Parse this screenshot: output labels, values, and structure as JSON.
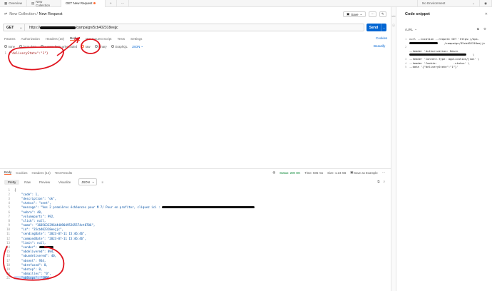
{
  "tabs": [
    {
      "label": "Overview"
    },
    {
      "label": "New Collection"
    },
    {
      "label": "GET New Request"
    }
  ],
  "environment": "No Environment",
  "breadcrumb": {
    "collection": "New Collection",
    "separator": "/",
    "request": "New Request"
  },
  "header": {
    "save_label": "Save",
    "edit_label": "✎"
  },
  "request": {
    "method": "GET",
    "url_prefix": "https://",
    "url_suffix": "/campaign/5cb402318eejjc",
    "send_label": "Send",
    "cookies_label": "Cookies",
    "beautify_label": "Beautify"
  },
  "request_tabs": [
    {
      "label": "Params"
    },
    {
      "label": "Authorization"
    },
    {
      "label": "Headers (10)"
    },
    {
      "label": "Body ●"
    },
    {
      "label": "Pre-request Script"
    },
    {
      "label": "Tests"
    },
    {
      "label": "Settings"
    }
  ],
  "body_options": [
    {
      "label": "none"
    },
    {
      "label": "form-data"
    },
    {
      "label": "x-www-form-urlencoded"
    },
    {
      "label": "raw"
    },
    {
      "label": "binary"
    },
    {
      "label": "GraphQL"
    }
  ],
  "body_format": "JSON",
  "request_body": "{\"deliveryState\":\"1\"}",
  "response": {
    "tabs": [
      {
        "label": "Body"
      },
      {
        "label": "Cookies"
      },
      {
        "label": "Headers (14)"
      },
      {
        "label": "Test Results"
      }
    ],
    "status": "Status: 200 OK",
    "time": "Time: 506 ms",
    "size": "Size: 1.24 KB",
    "save_label": "Save as Example",
    "views": [
      {
        "label": "Pretty"
      },
      {
        "label": "Raw"
      },
      {
        "label": "Preview"
      },
      {
        "label": "Visualize"
      }
    ],
    "view_format": "JSON",
    "lines": [
      "{",
      "    \"code\": 1,",
      "    \"description\": \"ok\",",
      "    \"status\": \"sent\",",
      "    \"message\": \"Vos 2 premières échéances pour M 7/ Pour en profiter, cliquez ici : ",
      "    \"nobra\": 40,",
      "    \"volumeparts\": 992,",
      "    \"click\": null,",
      "    \"name\": \"1685633296444090495265574ct8706\",",
      "    \"id\": \"35cb402318eejjc\",",
      "    \"sendingDate\": \"2023-07-11 15:46:46\",",
      "    \"commandDate\": \"2023-07-11 15:46:46\",",
      "    \"limit\": null,",
      "    \"sender\": ",
      "    \"nbdelivered\": 894,",
      "    \"nbundelivered\": 40,",
      "    \"nbsent\": 934,",
      "    \"nbrefused\": 0,",
      "    \"nbstop\": 0,",
      "    \"nbmailles\": \"0\",",
      "    \"nbStops\": \"180\""
    ]
  },
  "snippet": {
    "title": "Code snippet",
    "language": "cURL",
    "lines": [
      "curl --location --request GET 'https://api.",
      "    /campaign/35cb402318eejjc",
      "",
      "--header 'Authorization: Basic",
      "    \\",
      "--header 'Content-Type: application/json' \\",
      "--header 'Cookie:          .status' \\",
      "--data '{\"deliveryState\":\"1\"}'"
    ]
  }
}
